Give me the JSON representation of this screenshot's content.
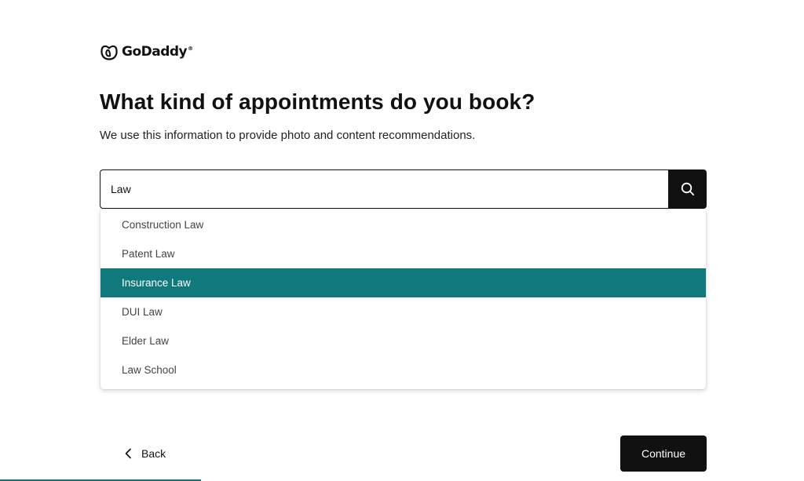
{
  "brand": {
    "name": "GoDaddy",
    "trademark": "®",
    "accent_color": "#10797b",
    "dark_color": "#111111"
  },
  "page": {
    "title": "What kind of appointments do you book?",
    "subtitle": "We use this information to provide photo and content recommendations."
  },
  "search": {
    "value": "Law",
    "button_icon": "search-icon"
  },
  "suggestions": [
    {
      "label": "Construction Law",
      "selected": false
    },
    {
      "label": "Patent Law",
      "selected": false
    },
    {
      "label": "Insurance Law",
      "selected": true
    },
    {
      "label": "DUI Law",
      "selected": false
    },
    {
      "label": "Elder Law",
      "selected": false
    },
    {
      "label": "Law School",
      "selected": false
    }
  ],
  "footer": {
    "back_label": "Back",
    "back_icon": "chevron-left-icon",
    "continue_label": "Continue"
  },
  "progress": {
    "fraction": 0.25
  }
}
